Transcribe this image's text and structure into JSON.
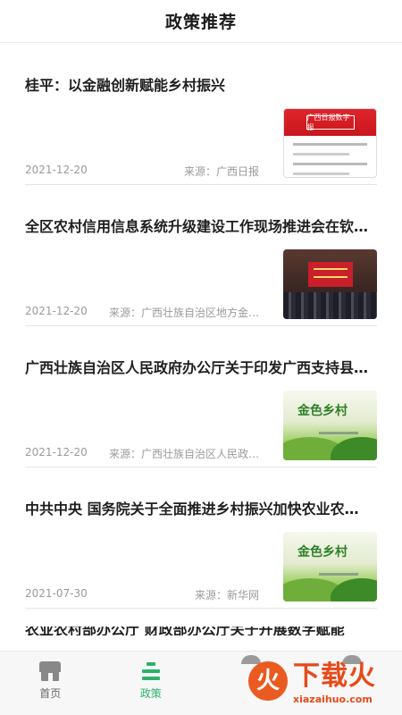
{
  "header": {
    "title": "政策推荐"
  },
  "articles": [
    {
      "title": "桂平：以金融创新赋能乡村振兴",
      "date": "2021-12-20",
      "source": "来源：广西日报",
      "thumb": "newspaper-thumbnail"
    },
    {
      "title": "全区农村信用信息系统升级建设工作现场推进会在钦…",
      "date": "2021-12-20",
      "source": "来源：广西壮族自治区地方金…",
      "thumb": "meeting-photo-thumbnail"
    },
    {
      "title": "广西壮族自治区人民政府办公厅关于印发广西支持县…",
      "date": "2021-12-20",
      "source": "来源：广西壮族自治区人民政…",
      "thumb": "rural-banner-thumbnail"
    },
    {
      "title": "中共中央 国务院关于全面推进乡村振兴加快农业农…",
      "date": "2021-07-30",
      "source": "来源：新华网",
      "thumb": "rural-banner-thumbnail"
    }
  ],
  "partial_article": {
    "title": "农业农村部办公厅 财政部办公厅关于开展数字赋能"
  },
  "thumb_text": {
    "newspaper_logo": "广西日报数字报",
    "rural_script": "金色乡村"
  },
  "tabbar": {
    "tabs": [
      {
        "label": "首页",
        "icon": "home-icon",
        "active": false
      },
      {
        "label": "政策",
        "icon": "policy-icon",
        "active": true
      }
    ]
  },
  "watermark": {
    "logo_char": "火",
    "text": "下载火",
    "url": "xiazaihuo.com"
  },
  "colors": {
    "accent": "#2bb36b",
    "watermark": "#e64a19"
  }
}
